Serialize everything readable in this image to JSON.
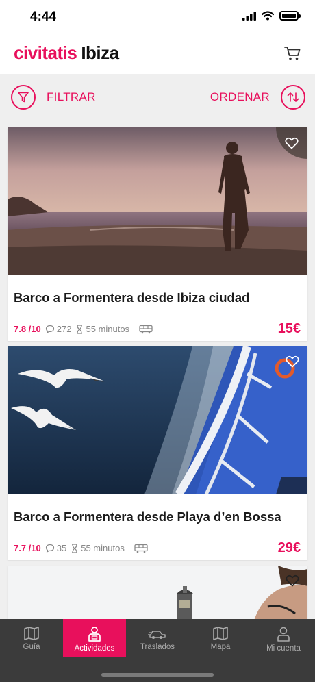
{
  "status": {
    "time": "4:44"
  },
  "header": {
    "brand_logo": "civitatis",
    "brand_city": "Ibiza"
  },
  "toolbar": {
    "filter_label": "FILTRAR",
    "order_label": "ORDENAR"
  },
  "cards": [
    {
      "title": "Barco a Formentera desde Ibiza ciudad",
      "rating": "7.8 /10",
      "reviews": "272",
      "duration": "55 minutos",
      "price": "15€"
    },
    {
      "title": "Barco a Formentera desde Playa d’en Bossa",
      "rating": "7.7 /10",
      "reviews": "35",
      "duration": "55 minutos",
      "price": "29€"
    }
  ],
  "tabs": [
    {
      "label": "Guía",
      "icon": "map-book-icon"
    },
    {
      "label": "Actividades",
      "icon": "person-activity-icon"
    },
    {
      "label": "Traslados",
      "icon": "transfer-car-icon"
    },
    {
      "label": "Mapa",
      "icon": "map-icon"
    },
    {
      "label": "Mi cuenta",
      "icon": "account-icon"
    }
  ],
  "colors": {
    "accent": "#e8105c",
    "tabbar": "#3b3b3b"
  }
}
